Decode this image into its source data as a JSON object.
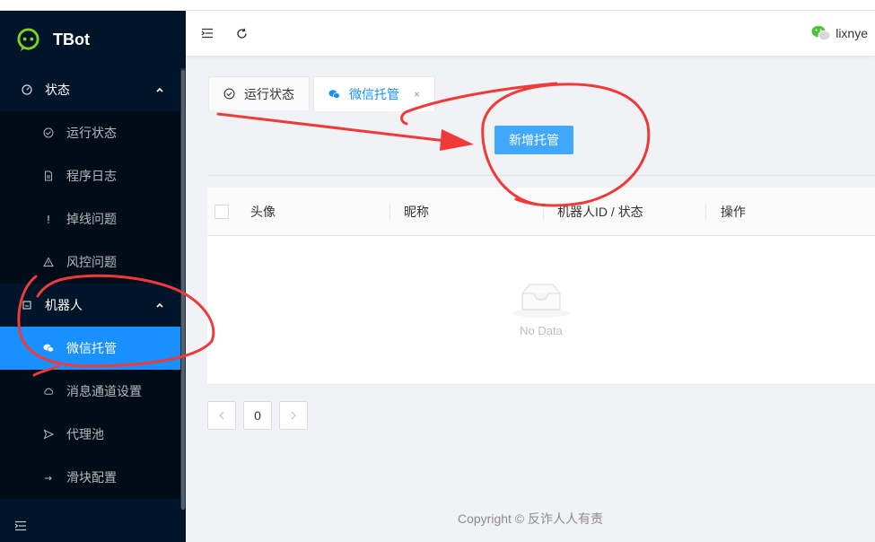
{
  "app": {
    "title": "TBot"
  },
  "sidebar": {
    "groups": [
      {
        "label": "状态",
        "icon": "dashboard-icon",
        "items": [
          {
            "label": "运行状态",
            "icon": "check-circle-icon"
          },
          {
            "label": "程序日志",
            "icon": "file-text-icon"
          },
          {
            "label": "掉线问题",
            "icon": "exclamation-icon"
          },
          {
            "label": "风控问题",
            "icon": "warning-icon"
          }
        ]
      },
      {
        "label": "机器人",
        "icon": "robot-icon",
        "items": [
          {
            "label": "微信托管",
            "icon": "wechat-icon",
            "active": true
          },
          {
            "label": "消息通道设置",
            "icon": "cloud-icon"
          },
          {
            "label": "代理池",
            "icon": "send-icon"
          },
          {
            "label": "滑块配置",
            "icon": "arrow-right-icon"
          }
        ]
      }
    ]
  },
  "header": {
    "username": "lixnye"
  },
  "tabs": [
    {
      "label": "运行状态",
      "icon": "check-circle-icon"
    },
    {
      "label": "微信托管",
      "icon": "wechat-icon",
      "active": true,
      "close": "×"
    }
  ],
  "toolbar": {
    "add_label": "新增托管"
  },
  "table": {
    "columns": [
      "头像",
      "昵称",
      "机器人ID / 状态",
      "操作"
    ],
    "empty_text": "No Data"
  },
  "pagination": {
    "current": "0"
  },
  "footer": {
    "copyright": "Copyright © 反诈人人有责"
  },
  "colors": {
    "sidebar": "#001529",
    "primary": "#1890ff",
    "button": "#40a9ff",
    "annotation": "#f03a3a"
  }
}
